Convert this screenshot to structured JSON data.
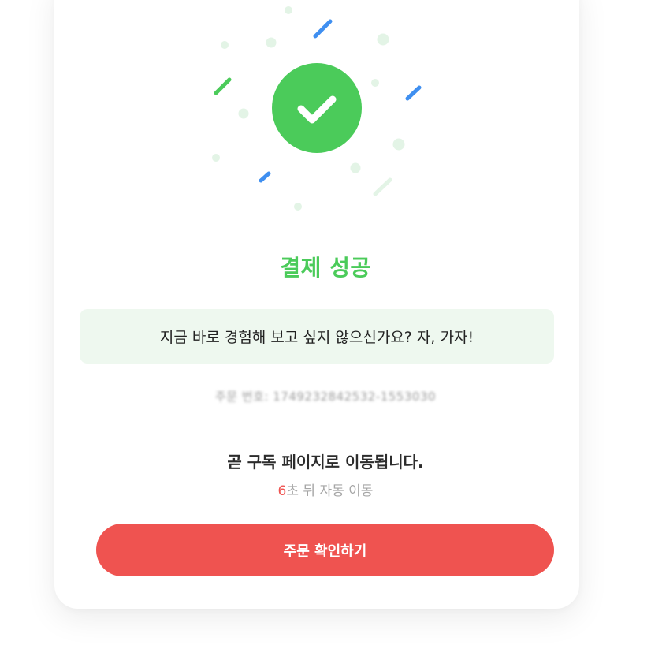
{
  "status": {
    "title": "결제 성공",
    "icon": "check-icon"
  },
  "message": "지금 바로 경험해 보고 싶지 않으신가요? 자, 가자!",
  "order": {
    "number_text": "주문 번호: 1749232842532-1553030"
  },
  "redirect": {
    "text": "곧 구독 페이지로 이동됩니다.",
    "seconds": "6",
    "suffix": "초 뒤 자동 이동"
  },
  "actions": {
    "confirm_label": "주문 확인하기"
  },
  "colors": {
    "success": "#4bcb5a",
    "accent": "#ef5350",
    "confetti_blue": "#3f8ff0",
    "confetti_light": "#e3f4e6",
    "message_bg": "#eef8ef"
  }
}
